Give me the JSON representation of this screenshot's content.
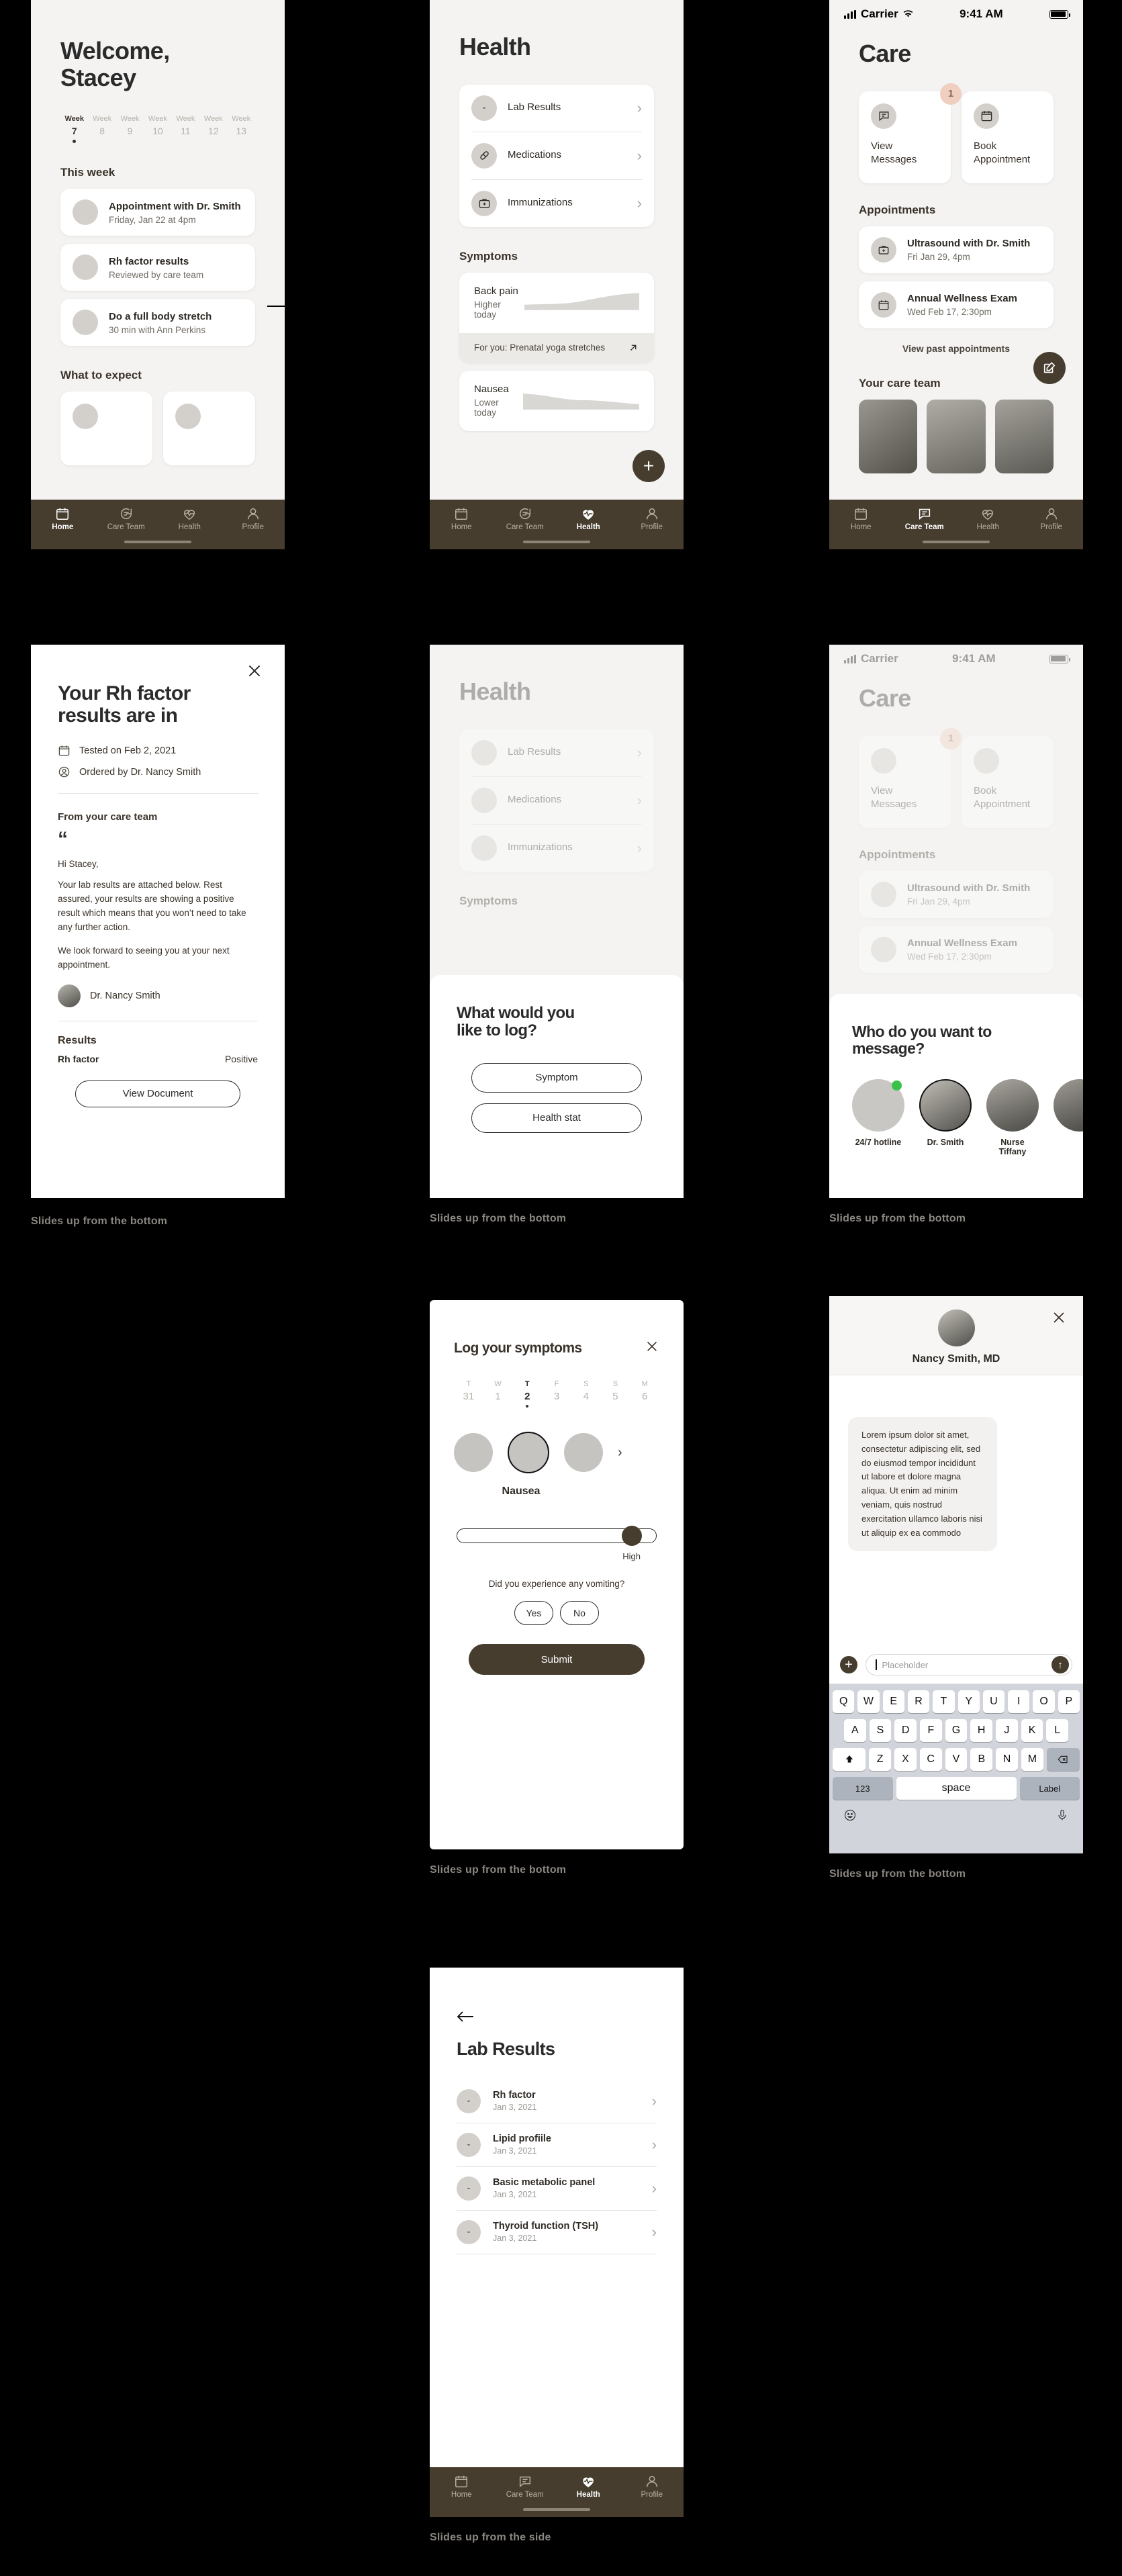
{
  "statusbar": {
    "carrier": "Carrier",
    "time": "9:41 AM"
  },
  "tabs": [
    {
      "label": "Home",
      "icon": "calendar-icon"
    },
    {
      "label": "Care Team",
      "icon": "chat-icon"
    },
    {
      "label": "Health",
      "icon": "heartbeat-icon"
    },
    {
      "label": "Profile",
      "icon": "person-icon"
    }
  ],
  "home": {
    "title": "Welcome,\nStacey",
    "title_line1": "Welcome,",
    "title_line2": "Stacey",
    "weeks": [
      {
        "label": "Week",
        "number": "7",
        "active": true
      },
      {
        "label": "Week",
        "number": "8",
        "active": false
      },
      {
        "label": "Week",
        "number": "9",
        "active": false
      },
      {
        "label": "Week",
        "number": "10",
        "active": false
      },
      {
        "label": "Week",
        "number": "11",
        "active": false
      },
      {
        "label": "Week",
        "number": "12",
        "active": false
      },
      {
        "label": "Week",
        "number": "13",
        "active": false
      }
    ],
    "section_this_week": "This week",
    "cards": [
      {
        "title": "Appointment with Dr. Smith",
        "sub": "Friday, Jan 22 at 4pm"
      },
      {
        "title": "Rh factor results",
        "sub": "Reviewed by care team"
      },
      {
        "title": "Do a full body stretch",
        "sub": "30 min with Ann Perkins"
      }
    ],
    "section_what_to_expect": "What to expect"
  },
  "health": {
    "title": "Health",
    "menu": [
      {
        "label": "Lab Results",
        "icon": "vial-icon"
      },
      {
        "label": "Medications",
        "icon": "pill-icon"
      },
      {
        "label": "Immunizations",
        "icon": "medkit-icon"
      }
    ],
    "section_symptoms": "Symptoms",
    "symptoms": [
      {
        "name": "Back pain",
        "trend": "Higher today"
      },
      {
        "name": "Nausea",
        "trend": "Lower today"
      }
    ],
    "foryou": "For you: Prenatal yoga stretches",
    "fab": "+"
  },
  "care": {
    "title": "Care",
    "actions": [
      {
        "label": "View\nMessages",
        "line1": "View",
        "line2": "Messages",
        "icon": "chat-icon",
        "badge": "1"
      },
      {
        "label": "Book\nAppointment",
        "line1": "Book",
        "line2": "Appointment",
        "icon": "calendar-icon",
        "badge": ""
      }
    ],
    "section_appointments": "Appointments",
    "appointments": [
      {
        "title": "Ultrasound with Dr. Smith",
        "sub": "Fri Jan 29, 4pm",
        "icon": "medkit-icon"
      },
      {
        "title": "Annual Wellness Exam",
        "sub": "Wed Feb 17, 2:30pm",
        "icon": "calendar-icon"
      }
    ],
    "view_past": "View past appointments",
    "section_care_team": "Your care team",
    "compose_icon": "compose-icon"
  },
  "rh_modal": {
    "close_icon": "close-icon",
    "title_line1": "Your Rh factor",
    "title_line2": "results are in",
    "tested_on": "Tested on Feb 2, 2021",
    "ordered_by": "Ordered by Dr. Nancy Smith",
    "from_care_team": "From your care team",
    "quote_mark": "“",
    "greeting": "Hi Stacey,",
    "body1": "Your lab results are attached below. Rest assured, your results are showing a positive result which means that you won’t need to take any further action.",
    "body2": "We look forward to seeing you at your next appointment.",
    "signature": "Dr. Nancy Smith",
    "results_heading": "Results",
    "result_name": "Rh factor",
    "result_value": "Positive",
    "button": "View Document",
    "caption": "Slides up from the bottom"
  },
  "log_modal": {
    "title_line1": "What would you",
    "title_line2": "like to log?",
    "options": [
      "Symptom",
      "Health stat"
    ],
    "caption": "Slides up from the bottom"
  },
  "message_modal": {
    "title_line1": "Who do you want to",
    "title_line2": "message?",
    "people": [
      {
        "name": "24/7 hotline",
        "online": true
      },
      {
        "name": "Dr. Smith",
        "online": false
      },
      {
        "name": "Nurse Tiffany",
        "online": false
      }
    ],
    "caption": "Slides up from the bottom"
  },
  "symptom_log": {
    "title": "Log your symptoms",
    "close_icon": "close-icon",
    "days": [
      {
        "dow": "T",
        "num": "31",
        "active": false
      },
      {
        "dow": "W",
        "num": "1",
        "active": false
      },
      {
        "dow": "T",
        "num": "2",
        "active": true
      },
      {
        "dow": "F",
        "num": "3",
        "active": false
      },
      {
        "dow": "S",
        "num": "4",
        "active": false
      },
      {
        "dow": "S",
        "num": "5",
        "active": false
      },
      {
        "dow": "M",
        "num": "6",
        "active": false
      }
    ],
    "selected_symptom": "Nausea",
    "next_icon": "chevron-right-icon",
    "slider_label": "High",
    "slider_percent": 88,
    "question": "Did you experience any vomiting?",
    "answers": [
      "Yes",
      "No"
    ],
    "submit": "Submit",
    "caption": "Slides up from the bottom"
  },
  "chat": {
    "close_icon": "close-icon",
    "name": "Nancy Smith, MD",
    "bubble": "Lorem ipsum dolor sit amet, consectetur adipiscing elit, sed do eiusmod tempor incididunt ut labore et dolore magna aliqua. Ut enim ad minim veniam, quis nostrud exercitation ullamco laboris nisi ut aliquip ex ea commodo",
    "input_placeholder": "Placeholder",
    "plus_icon": "plus-icon",
    "send_icon": "send-icon",
    "keyboard": {
      "row1": [
        "Q",
        "W",
        "E",
        "R",
        "T",
        "Y",
        "U",
        "I",
        "O",
        "P"
      ],
      "row2": [
        "A",
        "S",
        "D",
        "F",
        "G",
        "H",
        "J",
        "K",
        "L"
      ],
      "row3": [
        "Z",
        "X",
        "C",
        "V",
        "B",
        "N",
        "M"
      ],
      "shift": "shift-icon",
      "backspace": "backspace-icon",
      "numbers": "123",
      "space": "space",
      "label": "Label",
      "emoji": "emoji-icon",
      "mic": "microphone-icon"
    },
    "caption": "Slides up from the bottom"
  },
  "lab_results": {
    "back_icon": "back-arrow-icon",
    "title": "Lab Results",
    "items": [
      {
        "name": "Rh factor",
        "date": "Jan 3, 2021"
      },
      {
        "name": "Lipid profiile",
        "date": "Jan 3, 2021"
      },
      {
        "name": "Basic metabolic panel",
        "date": "Jan 3, 2021"
      },
      {
        "name": "Thyroid function (TSH)",
        "date": "Jan 3, 2021"
      }
    ],
    "caption": "Slides up from the side"
  },
  "colors": {
    "brand": "#463d2f",
    "bg": "#f4f3f1",
    "badge": "#f0cfc0",
    "online": "#39c24a"
  }
}
